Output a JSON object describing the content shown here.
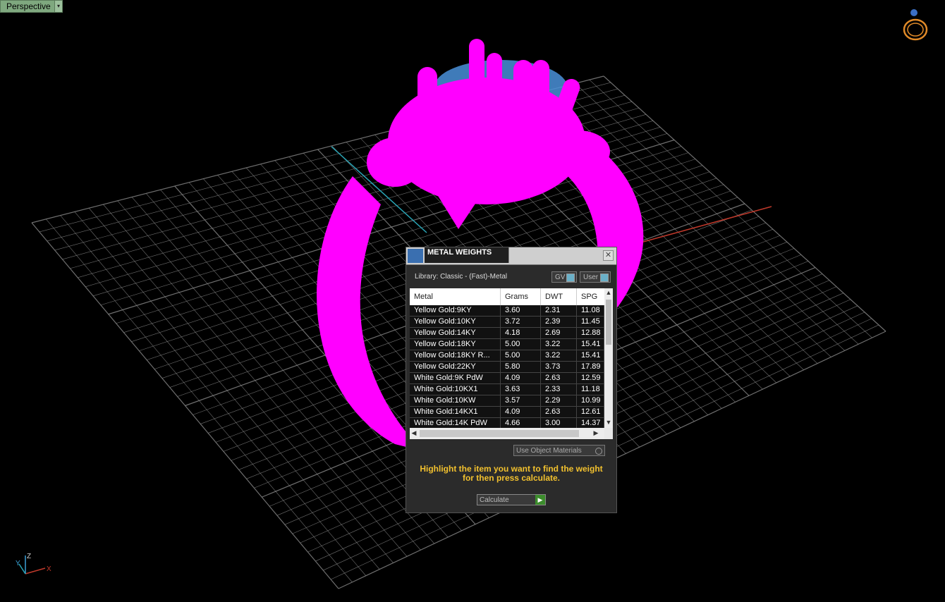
{
  "viewport": {
    "label": "Perspective",
    "dropdown_glyph": "▾",
    "grid_color": "#8a8a8a",
    "model_color": "#ff00ff",
    "stone_color": "#4a90d9",
    "axis_x_color": "#c0392b",
    "axis_y_color": "#2aa7b8",
    "gizmo": {
      "x": "X",
      "y": "Y",
      "z": "Z"
    },
    "viewcube_icon": "ring-icon"
  },
  "dialog": {
    "title": "METAL WEIGHTS",
    "close_glyph": "✕",
    "library_label": "Library: Classic - (Fast)-Metal",
    "toggle_gv": "GV",
    "toggle_user": "User",
    "columns": [
      "Metal",
      "Grams",
      "DWT",
      "SPG"
    ],
    "rows": [
      [
        "Yellow Gold:9KY",
        "3.60",
        "2.31",
        "11.08"
      ],
      [
        "Yellow Gold:10KY",
        "3.72",
        "2.39",
        "11.45"
      ],
      [
        "Yellow Gold:14KY",
        "4.18",
        "2.69",
        "12.88"
      ],
      [
        "Yellow Gold:18KY",
        "5.00",
        "3.22",
        "15.41"
      ],
      [
        "Yellow Gold:18KY R...",
        "5.00",
        "3.22",
        "15.41"
      ],
      [
        "Yellow Gold:22KY",
        "5.80",
        "3.73",
        "17.89"
      ],
      [
        "White Gold:9K PdW",
        "4.09",
        "2.63",
        "12.59"
      ],
      [
        "White Gold:10KX1",
        "3.63",
        "2.33",
        "11.18"
      ],
      [
        "White Gold:10KW",
        "3.57",
        "2.29",
        "10.99"
      ],
      [
        "White Gold:14KX1",
        "4.09",
        "2.63",
        "12.61"
      ],
      [
        "White Gold:14K PdW",
        "4.66",
        "3.00",
        "14.37"
      ]
    ],
    "use_object_materials": "Use Object Materials",
    "hint": "Highlight the item you want to find the weight for then press calculate.",
    "calculate_label": "Calculate",
    "calculate_glyph": "▶"
  }
}
